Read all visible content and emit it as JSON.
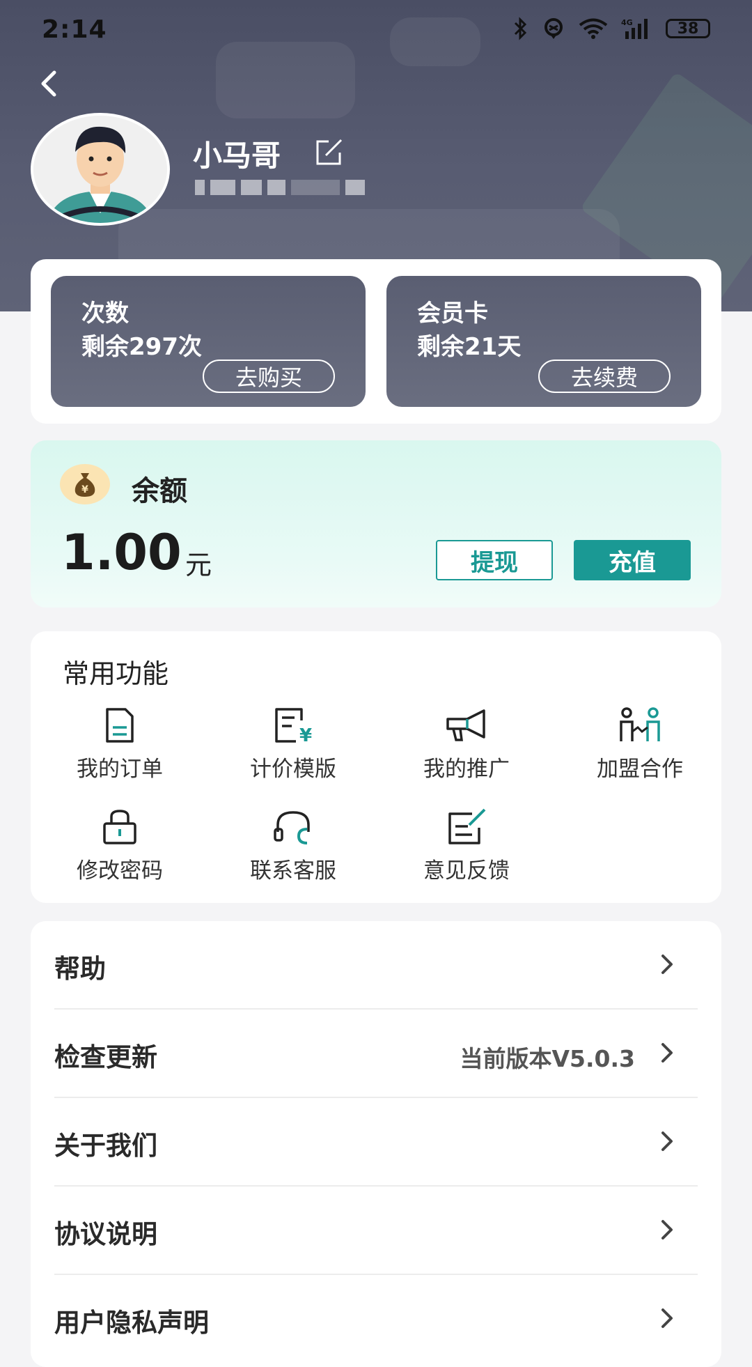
{
  "status_bar": {
    "time": "2:14",
    "battery": "38",
    "network": "4G"
  },
  "profile": {
    "name": "小马哥"
  },
  "cards": [
    {
      "title": "次数",
      "subtitle": "剩余297次",
      "button": "去购买"
    },
    {
      "title": "会员卡",
      "subtitle": "剩余21天",
      "button": "去续费"
    }
  ],
  "balance": {
    "label": "余额",
    "amount": "1.00",
    "unit": "元",
    "withdraw": "提现",
    "recharge": "充值"
  },
  "functions": {
    "title": "常用功能",
    "items": [
      {
        "label": "我的订单",
        "icon": "order-icon"
      },
      {
        "label": "计价模版",
        "icon": "pricing-template-icon"
      },
      {
        "label": "我的推广",
        "icon": "megaphone-icon"
      },
      {
        "label": "加盟合作",
        "icon": "partnership-icon"
      },
      {
        "label": "修改密码",
        "icon": "lock-icon"
      },
      {
        "label": "联系客服",
        "icon": "headset-icon"
      },
      {
        "label": "意见反馈",
        "icon": "feedback-icon"
      }
    ]
  },
  "menu": [
    {
      "label": "帮助",
      "value": ""
    },
    {
      "label": "检查更新",
      "value": "当前版本V5.0.3"
    },
    {
      "label": "关于我们",
      "value": ""
    },
    {
      "label": "协议说明",
      "value": ""
    },
    {
      "label": "用户隐私声明",
      "value": ""
    }
  ],
  "colors": {
    "accent": "#1a9994",
    "header": "#4a4e64",
    "card": "#62667a"
  }
}
